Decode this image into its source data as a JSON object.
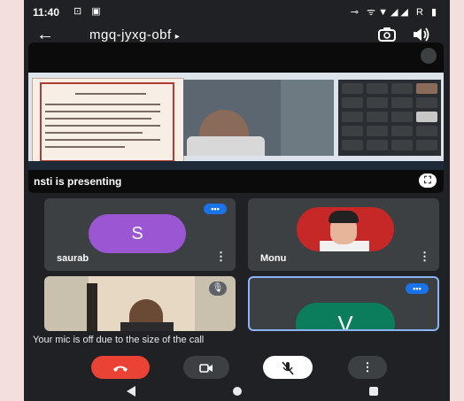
{
  "status": {
    "time": "11:40",
    "left_icons": "⊡ ▣",
    "right_icons": "⊸ ᯤ▼◢◢ R ▮"
  },
  "meeting": {
    "code": "mgq-jyxg-obf",
    "caret": "▸",
    "back_icon": "arrow-left-icon",
    "camera_switch_icon": "camera-switch-icon",
    "speaker_icon": "speaker-icon"
  },
  "presentation": {
    "label": "nsti is presenting",
    "fullscreen_icon": "fullscreen-icon",
    "mute_icon": "mic-off-icon"
  },
  "participants": [
    {
      "name": "saurab",
      "avatar_letter": "S",
      "avatar_color": "#9b57d3",
      "badge": "audio-indicator"
    },
    {
      "name": "Monu",
      "avatar_type": "photo"
    },
    {
      "name": "",
      "avatar_type": "video",
      "badge": "mic-off-icon"
    },
    {
      "name": "",
      "avatar_letter": "V",
      "avatar_color": "#0b7d5c",
      "badge": "audio-indicator",
      "active": true
    }
  ],
  "notice": "Your mic is off due to the size of the call",
  "controls": {
    "end_call_icon": "phone-hangup-icon",
    "camera_icon": "video-camera-icon",
    "mic_icon": "mic-off-icon",
    "more_icon": "more-vertical-icon"
  },
  "colors": {
    "background": "#202124",
    "tile": "#3c4043",
    "end_call": "#ea4335",
    "accent": "#8ab4f8"
  }
}
